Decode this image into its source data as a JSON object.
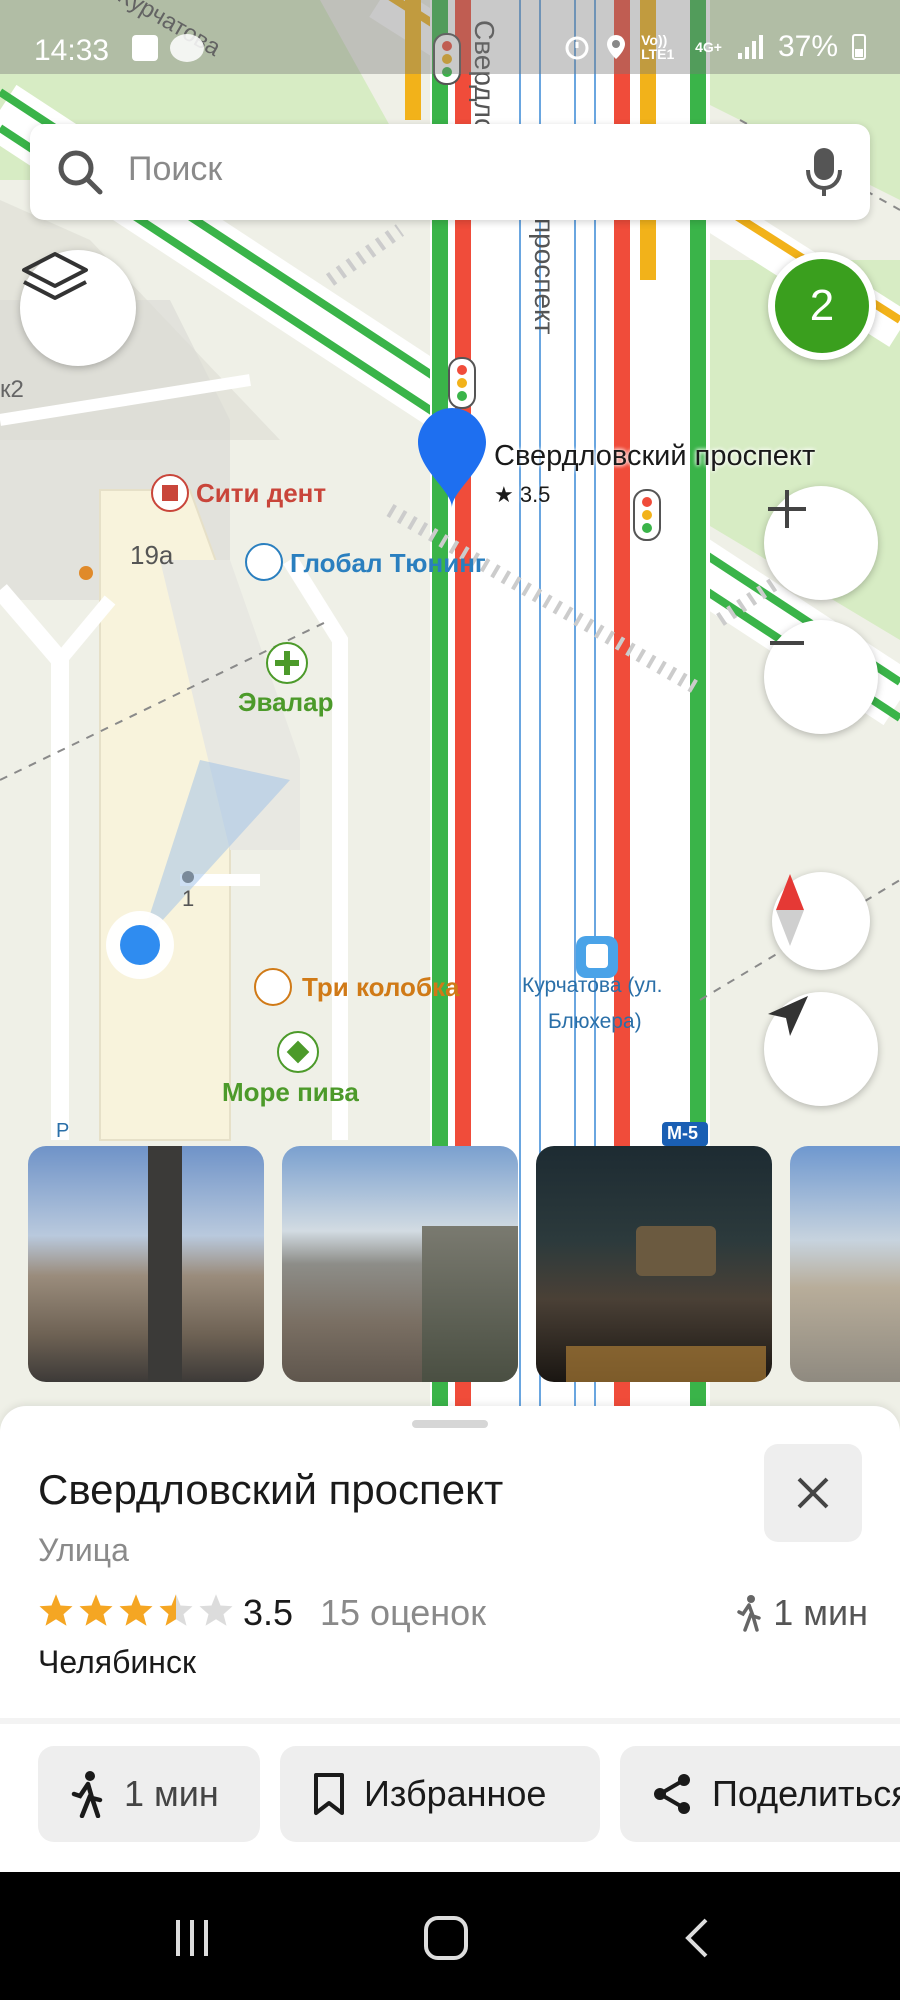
{
  "status_bar": {
    "time": "14:33",
    "battery": "37%",
    "network": "4G+",
    "volte": "Vo)) LTE1"
  },
  "search": {
    "placeholder": "Поиск"
  },
  "map": {
    "cluster_count": "2",
    "street_vertical": "Свердловский проспект",
    "street_top": "Курчатова",
    "street_mid": "проспект",
    "street_top_right": "Свердлс",
    "marker_title": "Свердловский проспект",
    "marker_rating": "★ 3.5",
    "pois": [
      {
        "name": "Сити дент",
        "color": "#c9453a"
      },
      {
        "name": "Глобал Тюнинг",
        "color": "#2a7fbf"
      },
      {
        "name": "Эвалар",
        "color": "#4c9a2a"
      },
      {
        "name": "Три колобка",
        "color": "#d07a17"
      },
      {
        "name": "Море пива",
        "color": "#4c9a2a"
      }
    ],
    "house_19a": "19а",
    "house_k2": "к2",
    "house_1": "1",
    "tram_stop_line1": "Курчатова (ул.",
    "tram_stop_line2": "Блюхера)",
    "road_badge": "М-5",
    "p_label": "P"
  },
  "place": {
    "title": "Свердловский проспект",
    "category": "Улица",
    "rating": "3.5",
    "rating_value": 3.5,
    "rating_count": "15 оценок",
    "walk_time": "1 мин",
    "city": "Челябинск"
  },
  "actions": {
    "route": "1 мин",
    "favorite": "Избранное",
    "share": "Поделиться"
  },
  "colors": {
    "accent_green": "#3a9f1e",
    "marker_blue": "#1e6ff0",
    "star": "#f5a623",
    "road_red": "#f04c3a",
    "road_green": "#3ab449",
    "road_yellow": "#f2b21a"
  }
}
